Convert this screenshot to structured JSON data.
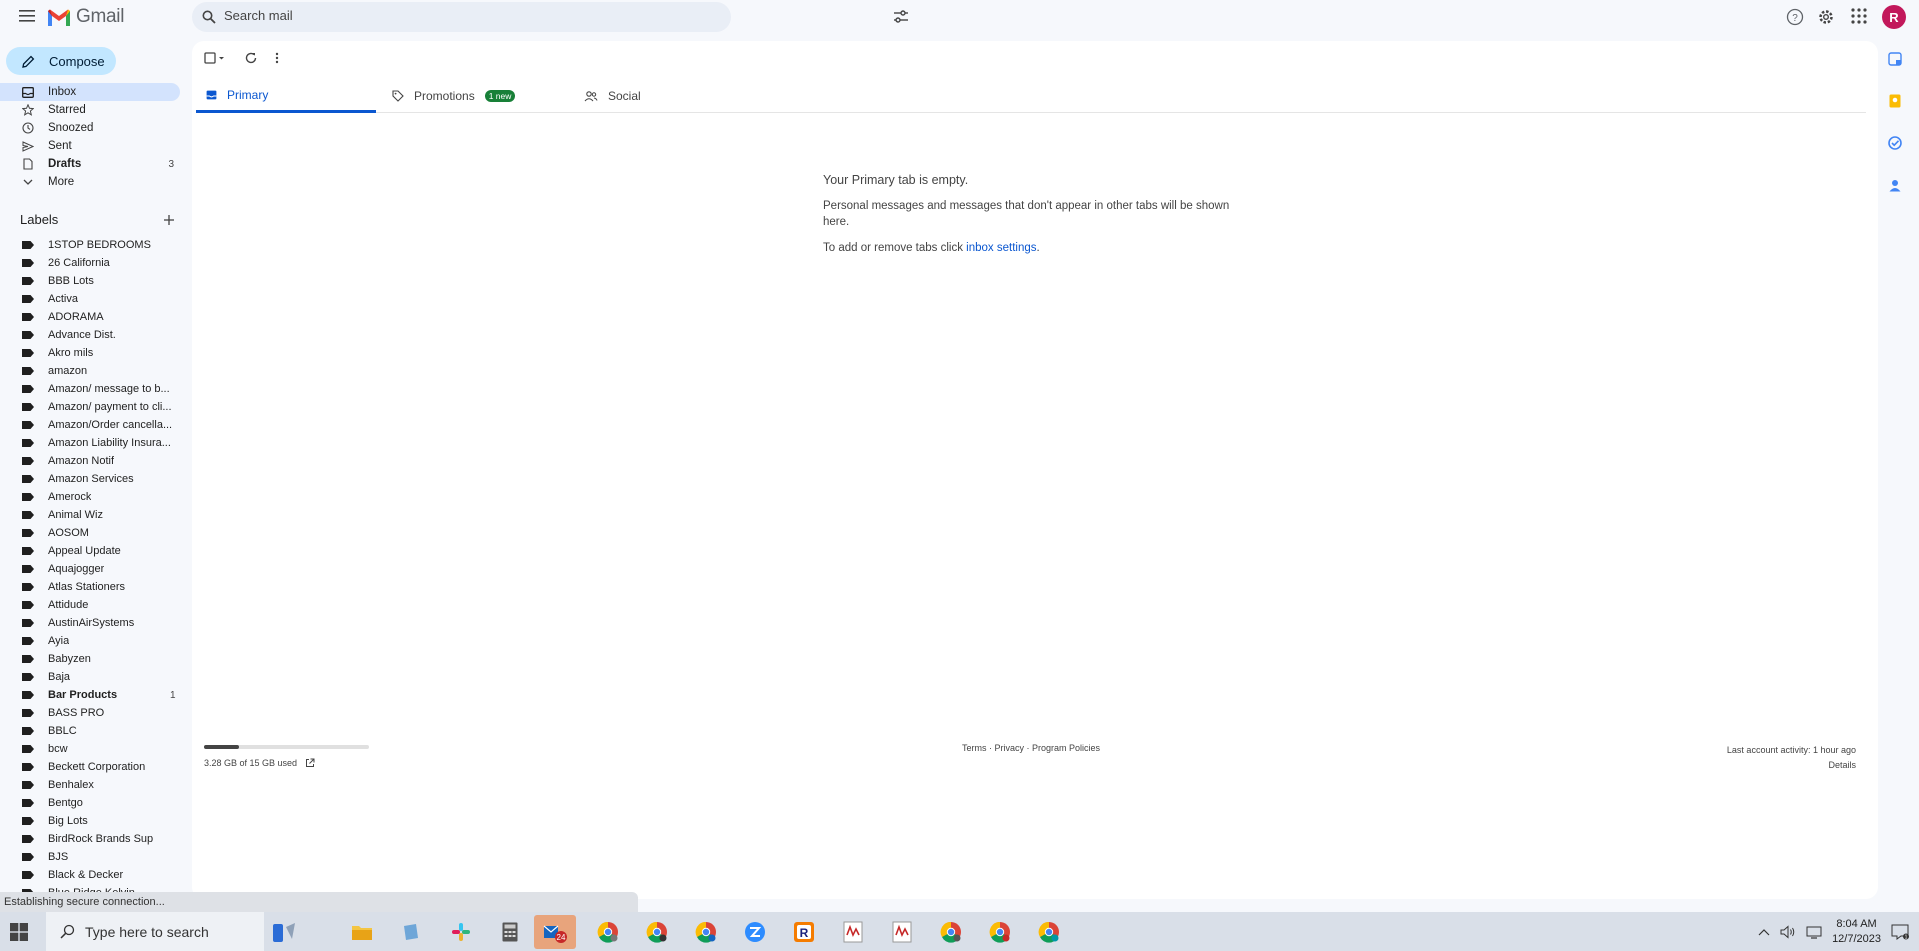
{
  "app": {
    "name": "Gmail"
  },
  "search": {
    "placeholder": "Search mail"
  },
  "user": {
    "initial": "R"
  },
  "compose_label": "Compose",
  "nav": [
    {
      "label": "Inbox",
      "icon": "inbox-icon",
      "active": true,
      "count": ""
    },
    {
      "label": "Starred",
      "icon": "star-icon",
      "count": ""
    },
    {
      "label": "Snoozed",
      "icon": "clock-icon",
      "count": ""
    },
    {
      "label": "Sent",
      "icon": "send-icon",
      "count": ""
    },
    {
      "label": "Drafts",
      "icon": "draft-icon",
      "count": "3",
      "bold": true
    },
    {
      "label": "More",
      "icon": "chevron-down-icon",
      "count": ""
    }
  ],
  "labels_title": "Labels",
  "labels": [
    {
      "name": "1STOP BEDROOMS"
    },
    {
      "name": "26 California"
    },
    {
      "name": "BBB Lots"
    },
    {
      "name": "Activa"
    },
    {
      "name": "ADORAMA"
    },
    {
      "name": "Advance Dist."
    },
    {
      "name": "Akro mils"
    },
    {
      "name": "amazon"
    },
    {
      "name": "Amazon/ message to b..."
    },
    {
      "name": "Amazon/ payment to cli..."
    },
    {
      "name": "Amazon/Order cancella..."
    },
    {
      "name": "Amazon Liability Insura..."
    },
    {
      "name": "Amazon Notif"
    },
    {
      "name": "Amazon Services"
    },
    {
      "name": "Amerock"
    },
    {
      "name": "Animal Wiz"
    },
    {
      "name": "AOSOM"
    },
    {
      "name": "Appeal Update"
    },
    {
      "name": "Aquajogger"
    },
    {
      "name": "Atlas Stationers"
    },
    {
      "name": "Attidude"
    },
    {
      "name": "AustinAirSystems"
    },
    {
      "name": "Ayia"
    },
    {
      "name": "Babyzen"
    },
    {
      "name": "Baja"
    },
    {
      "name": "Bar Products",
      "bold": true,
      "count": "1"
    },
    {
      "name": "BASS PRO"
    },
    {
      "name": "BBLC"
    },
    {
      "name": "bcw"
    },
    {
      "name": "Beckett Corporation"
    },
    {
      "name": "Benhalex"
    },
    {
      "name": "Bentgo"
    },
    {
      "name": "Big Lots"
    },
    {
      "name": "BirdRock Brands Sup"
    },
    {
      "name": "BJS"
    },
    {
      "name": "Black & Decker"
    },
    {
      "name": "Blue Ridge Kelvin"
    }
  ],
  "tabs": [
    {
      "label": "Primary",
      "icon": "inbox-icon",
      "active": true
    },
    {
      "label": "Promotions",
      "icon": "tag-icon",
      "badge": "1 new"
    },
    {
      "label": "Social",
      "icon": "people-icon"
    }
  ],
  "empty_state": {
    "title": "Your Primary tab is empty.",
    "body": "Personal messages and messages that don't appear in other tabs will be shown here.",
    "settings_prefix": "To add or remove tabs click ",
    "settings_link": "inbox settings",
    "settings_suffix": "."
  },
  "footer": {
    "storage_used_fraction": 0.21,
    "storage_text": "3.28 GB of 15 GB used",
    "links": "Terms · Privacy · Program Policies",
    "activity": "Last account activity: 1 hour ago",
    "details": "Details"
  },
  "status_text": "Establishing secure connection...",
  "taskbar": {
    "search_placeholder": "Type here to search",
    "time": "8:04 AM",
    "date": "12/7/2023",
    "mail_badge": "24"
  },
  "colors": {
    "accent": "#0b57d0",
    "compose_bg": "#c2e7ff",
    "active_nav": "#d3e3fd",
    "avatar": "#c2185b",
    "badge": "#188038"
  }
}
